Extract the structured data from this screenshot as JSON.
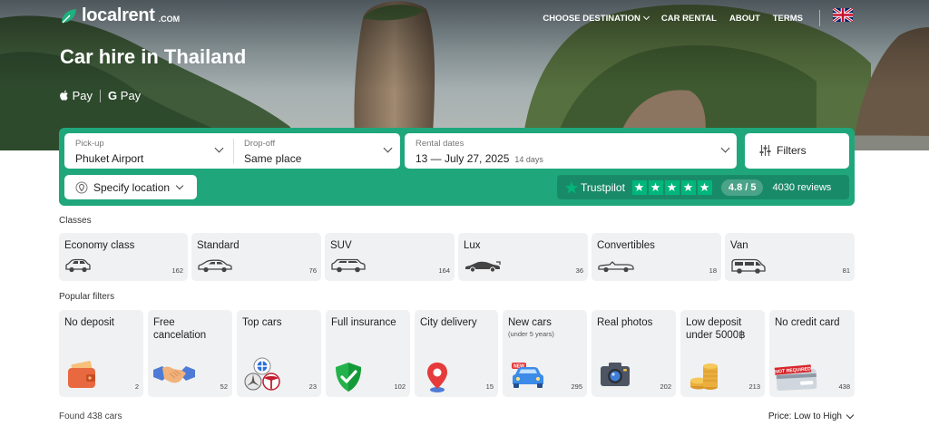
{
  "header": {
    "logo_text": "localrent",
    "logo_suffix": ".COM",
    "nav": {
      "choose_destination": "CHOOSE DESTINATION",
      "car_rental": "CAR RENTAL",
      "about": "ABOUT",
      "terms": "TERMS"
    },
    "language_icon": "uk-flag-icon"
  },
  "hero": {
    "title": "Car hire in Thailand",
    "payment": {
      "apple": "Pay",
      "google": "Pay"
    }
  },
  "search": {
    "pickup": {
      "label": "Pick-up",
      "value": "Phuket Airport"
    },
    "dropoff": {
      "label": "Drop-off",
      "value": "Same place"
    },
    "dates": {
      "label": "Rental dates",
      "value": "13 — July 27, 2025",
      "duration": "14 days"
    },
    "filters_label": "Filters",
    "specify_location": "Specify location"
  },
  "trustpilot": {
    "name": "Trustpilot",
    "rating": "4.8 / 5",
    "reviews": "4030 reviews",
    "stars": 5
  },
  "classes": {
    "label": "Classes",
    "items": [
      {
        "title": "Economy class",
        "count": "162",
        "icon": "economy-car-icon"
      },
      {
        "title": "Standard",
        "count": "76",
        "icon": "sedan-car-icon"
      },
      {
        "title": "SUV",
        "count": "164",
        "icon": "suv-car-icon"
      },
      {
        "title": "Lux",
        "count": "36",
        "icon": "sports-car-icon"
      },
      {
        "title": "Convertibles",
        "count": "18",
        "icon": "convertible-car-icon"
      },
      {
        "title": "Van",
        "count": "81",
        "icon": "van-icon"
      }
    ]
  },
  "popular": {
    "label": "Popular filters",
    "items": [
      {
        "title": "No deposit",
        "sub": "",
        "count": "2",
        "icon": "wallet-icon"
      },
      {
        "title": "Free cancelation",
        "sub": "",
        "count": "52",
        "icon": "handshake-icon"
      },
      {
        "title": "Top cars",
        "sub": "",
        "count": "23",
        "icon": "car-brands-icon"
      },
      {
        "title": "Full insurance",
        "sub": "",
        "count": "102",
        "icon": "shield-check-icon"
      },
      {
        "title": "City delivery",
        "sub": "",
        "count": "15",
        "icon": "map-pin-icon"
      },
      {
        "title": "New cars",
        "sub": "(under 5 years)",
        "count": "295",
        "icon": "new-car-icon"
      },
      {
        "title": "Real photos",
        "sub": "",
        "count": "202",
        "icon": "camera-icon"
      },
      {
        "title": "Low deposit under 5000฿",
        "sub": "",
        "count": "213",
        "icon": "coins-icon"
      },
      {
        "title": "No credit card",
        "sub": "",
        "count": "438",
        "icon": "credit-card-icon",
        "card_text": "NOT REQUIRED"
      }
    ]
  },
  "results": {
    "found": "Found 438 cars",
    "sort": "Price: Low to High"
  },
  "colors": {
    "brand_green": "#1fa77b",
    "trustpilot_green": "#00b67a",
    "card_bg": "#f0f1f2"
  }
}
